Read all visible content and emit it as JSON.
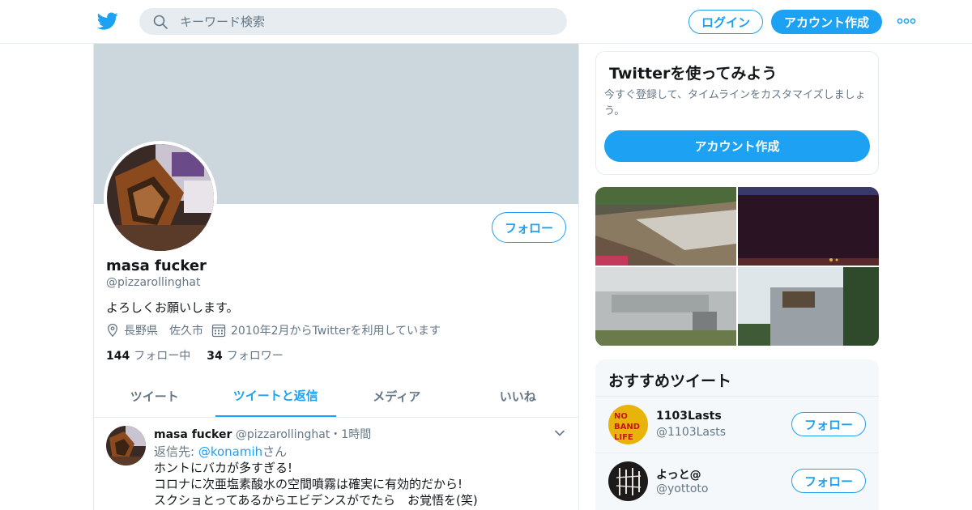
{
  "header": {
    "search_placeholder": "キーワード検索",
    "login_label": "ログイン",
    "signup_label": "アカウント作成"
  },
  "profile": {
    "name": "masa fucker",
    "handle": "@pizzarollinghat",
    "follow_label": "フォロー",
    "bio": "よろしくお願いします。",
    "location": "長野県　佐久市",
    "joined": "2010年2月からTwitterを利用しています",
    "following_count": "144",
    "following_label": "フォロー中",
    "followers_count": "34",
    "followers_label": "フォロワー"
  },
  "tabs": [
    {
      "label": "ツイート",
      "active": false
    },
    {
      "label": "ツイートと返信",
      "active": true
    },
    {
      "label": "メディア",
      "active": false
    },
    {
      "label": "いいね",
      "active": false
    }
  ],
  "tweet": {
    "name": "masa fucker",
    "handle": "@pizzarollinghat",
    "separator": "・",
    "time": "1時間",
    "reply_prefix": "返信先: ",
    "reply_to": "@konamih",
    "reply_suffix": "さん",
    "lines": [
      "ホントにバカが多すぎる!",
      "コロナに次亜塩素酸水の空間噴霧は確実に有効的だから!",
      "スクショとってあるからエビデンスがでたら　お覚悟を(笑)"
    ]
  },
  "signup_card": {
    "title": "Twitterを使ってみよう",
    "description": "今すぐ登録して、タイムラインをカスタマイズしましょう。",
    "button_label": "アカウント作成"
  },
  "recommended": {
    "title": "おすすめツイート",
    "accounts": [
      {
        "name": "1103Lasts",
        "handle": "@1103Lasts",
        "follow_label": "フォロー"
      },
      {
        "name": "よっと@",
        "handle": "@yottoto",
        "follow_label": "フォロー"
      }
    ]
  },
  "colors": {
    "accent": "#1da1f2",
    "banner": "#ccd6dd",
    "muted_text": "#657786"
  },
  "icons": [
    "twitter-bird-icon",
    "search-icon",
    "more-dots-icon",
    "location-pin-icon",
    "calendar-icon",
    "chevron-down-icon"
  ]
}
